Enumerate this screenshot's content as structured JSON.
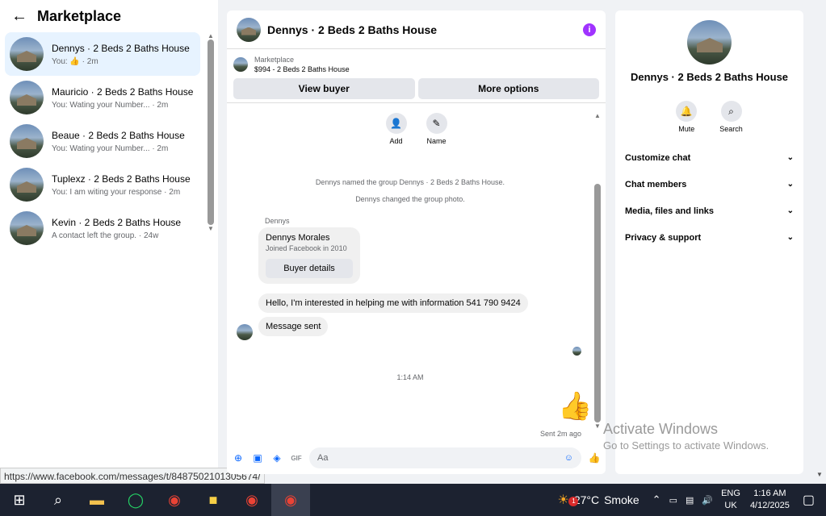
{
  "sidebar": {
    "title": "Marketplace",
    "back_icon": "arrow-left-icon",
    "conversations": [
      {
        "name": "Dennys · 2 Beds 2 Baths House",
        "preview": "You: 👍 · 2m",
        "active": true
      },
      {
        "name": "Mauricio · 2 Beds 2 Baths House",
        "preview": "You: Wating your Number... · 2m"
      },
      {
        "name": "Beaue · 2 Beds 2 Baths House",
        "preview": "You: Wating your Number... · 2m"
      },
      {
        "name": "Tuplexz · 2 Beds 2 Baths House",
        "preview": "You: I am witing your response · 2m"
      },
      {
        "name": "Kevin · 2 Beds 2 Baths House",
        "preview": "A contact left the group. · 24w"
      }
    ]
  },
  "status_url": "https://www.facebook.com/messages/t/8487502101305674/",
  "chat": {
    "title": "Dennys · 2 Beds 2 Baths House",
    "marketplace_label": "Marketplace",
    "listing": "$994 - 2 Beds 2 Baths House",
    "view_buyer": "View buyer",
    "more_options": "More options",
    "add_label": "Add",
    "name_label": "Name",
    "system_1": "Dennys named the group Dennys · 2 Beds 2 Baths House.",
    "system_2": "Dennys changed the group photo.",
    "sender": "Dennys",
    "card_name": "Dennys Morales",
    "card_sub": "Joined Facebook in 2010",
    "buyer_details": "Buyer details",
    "msg_1": "Hello, I'm interested in helping me with information 541 790 9424",
    "msg_2": "Message sent",
    "timestamp": "1:14 AM",
    "sent_status": "Sent 2m ago",
    "input_placeholder": "Aa"
  },
  "info": {
    "title": "Dennys · 2 Beds 2 Baths House",
    "mute": "Mute",
    "search": "Search",
    "sections": [
      "Customize chat",
      "Chat members",
      "Media, files and links",
      "Privacy & support"
    ]
  },
  "watermark": {
    "line1": "Activate Windows",
    "line2": "Go to Settings to activate Windows."
  },
  "taskbar": {
    "weather_temp": "27°C",
    "weather_text": "Smoke",
    "weather_badge": "1",
    "lang_1": "ENG",
    "lang_2": "UK",
    "time": "1:16 AM",
    "date": "4/12/2025"
  },
  "colors": {
    "accent": "#0866ff",
    "active_conv": "#e7f3ff",
    "info": "#a033ff",
    "like": "#5b5bd6"
  }
}
